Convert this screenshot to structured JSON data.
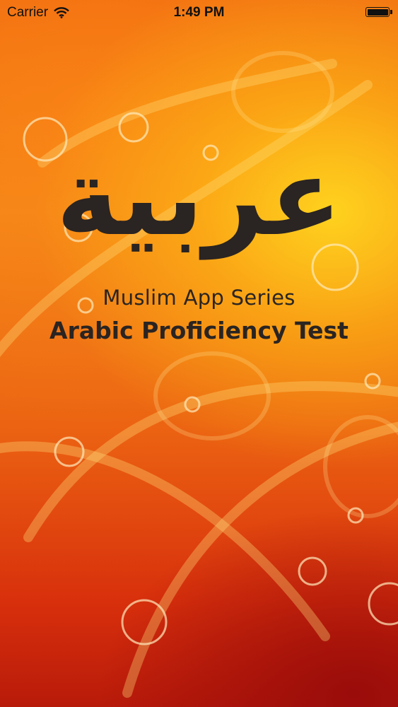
{
  "status_bar": {
    "carrier": "Carrier",
    "time": "1:49 PM",
    "wifi_icon": "wifi-icon",
    "battery_icon": "battery-icon",
    "battery_level": 1.0
  },
  "splash": {
    "arabic_logo": "عربية",
    "series_label": "Muslim App Series",
    "app_title": "Arabic Proficiency Test"
  },
  "colors": {
    "text_dark": "#2a2422",
    "background_top": "#f06a12",
    "background_highlight": "#ffd61e",
    "background_bottom": "#b81a0a"
  }
}
